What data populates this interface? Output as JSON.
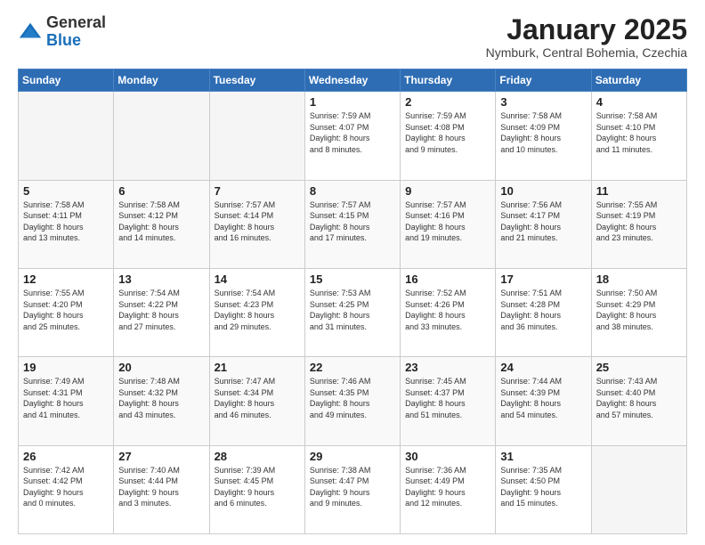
{
  "logo": {
    "general": "General",
    "blue": "Blue"
  },
  "header": {
    "month": "January 2025",
    "location": "Nymburk, Central Bohemia, Czechia"
  },
  "weekdays": [
    "Sunday",
    "Monday",
    "Tuesday",
    "Wednesday",
    "Thursday",
    "Friday",
    "Saturday"
  ],
  "weeks": [
    [
      {
        "day": "",
        "info": ""
      },
      {
        "day": "",
        "info": ""
      },
      {
        "day": "",
        "info": ""
      },
      {
        "day": "1",
        "info": "Sunrise: 7:59 AM\nSunset: 4:07 PM\nDaylight: 8 hours\nand 8 minutes."
      },
      {
        "day": "2",
        "info": "Sunrise: 7:59 AM\nSunset: 4:08 PM\nDaylight: 8 hours\nand 9 minutes."
      },
      {
        "day": "3",
        "info": "Sunrise: 7:58 AM\nSunset: 4:09 PM\nDaylight: 8 hours\nand 10 minutes."
      },
      {
        "day": "4",
        "info": "Sunrise: 7:58 AM\nSunset: 4:10 PM\nDaylight: 8 hours\nand 11 minutes."
      }
    ],
    [
      {
        "day": "5",
        "info": "Sunrise: 7:58 AM\nSunset: 4:11 PM\nDaylight: 8 hours\nand 13 minutes."
      },
      {
        "day": "6",
        "info": "Sunrise: 7:58 AM\nSunset: 4:12 PM\nDaylight: 8 hours\nand 14 minutes."
      },
      {
        "day": "7",
        "info": "Sunrise: 7:57 AM\nSunset: 4:14 PM\nDaylight: 8 hours\nand 16 minutes."
      },
      {
        "day": "8",
        "info": "Sunrise: 7:57 AM\nSunset: 4:15 PM\nDaylight: 8 hours\nand 17 minutes."
      },
      {
        "day": "9",
        "info": "Sunrise: 7:57 AM\nSunset: 4:16 PM\nDaylight: 8 hours\nand 19 minutes."
      },
      {
        "day": "10",
        "info": "Sunrise: 7:56 AM\nSunset: 4:17 PM\nDaylight: 8 hours\nand 21 minutes."
      },
      {
        "day": "11",
        "info": "Sunrise: 7:55 AM\nSunset: 4:19 PM\nDaylight: 8 hours\nand 23 minutes."
      }
    ],
    [
      {
        "day": "12",
        "info": "Sunrise: 7:55 AM\nSunset: 4:20 PM\nDaylight: 8 hours\nand 25 minutes."
      },
      {
        "day": "13",
        "info": "Sunrise: 7:54 AM\nSunset: 4:22 PM\nDaylight: 8 hours\nand 27 minutes."
      },
      {
        "day": "14",
        "info": "Sunrise: 7:54 AM\nSunset: 4:23 PM\nDaylight: 8 hours\nand 29 minutes."
      },
      {
        "day": "15",
        "info": "Sunrise: 7:53 AM\nSunset: 4:25 PM\nDaylight: 8 hours\nand 31 minutes."
      },
      {
        "day": "16",
        "info": "Sunrise: 7:52 AM\nSunset: 4:26 PM\nDaylight: 8 hours\nand 33 minutes."
      },
      {
        "day": "17",
        "info": "Sunrise: 7:51 AM\nSunset: 4:28 PM\nDaylight: 8 hours\nand 36 minutes."
      },
      {
        "day": "18",
        "info": "Sunrise: 7:50 AM\nSunset: 4:29 PM\nDaylight: 8 hours\nand 38 minutes."
      }
    ],
    [
      {
        "day": "19",
        "info": "Sunrise: 7:49 AM\nSunset: 4:31 PM\nDaylight: 8 hours\nand 41 minutes."
      },
      {
        "day": "20",
        "info": "Sunrise: 7:48 AM\nSunset: 4:32 PM\nDaylight: 8 hours\nand 43 minutes."
      },
      {
        "day": "21",
        "info": "Sunrise: 7:47 AM\nSunset: 4:34 PM\nDaylight: 8 hours\nand 46 minutes."
      },
      {
        "day": "22",
        "info": "Sunrise: 7:46 AM\nSunset: 4:35 PM\nDaylight: 8 hours\nand 49 minutes."
      },
      {
        "day": "23",
        "info": "Sunrise: 7:45 AM\nSunset: 4:37 PM\nDaylight: 8 hours\nand 51 minutes."
      },
      {
        "day": "24",
        "info": "Sunrise: 7:44 AM\nSunset: 4:39 PM\nDaylight: 8 hours\nand 54 minutes."
      },
      {
        "day": "25",
        "info": "Sunrise: 7:43 AM\nSunset: 4:40 PM\nDaylight: 8 hours\nand 57 minutes."
      }
    ],
    [
      {
        "day": "26",
        "info": "Sunrise: 7:42 AM\nSunset: 4:42 PM\nDaylight: 9 hours\nand 0 minutes."
      },
      {
        "day": "27",
        "info": "Sunrise: 7:40 AM\nSunset: 4:44 PM\nDaylight: 9 hours\nand 3 minutes."
      },
      {
        "day": "28",
        "info": "Sunrise: 7:39 AM\nSunset: 4:45 PM\nDaylight: 9 hours\nand 6 minutes."
      },
      {
        "day": "29",
        "info": "Sunrise: 7:38 AM\nSunset: 4:47 PM\nDaylight: 9 hours\nand 9 minutes."
      },
      {
        "day": "30",
        "info": "Sunrise: 7:36 AM\nSunset: 4:49 PM\nDaylight: 9 hours\nand 12 minutes."
      },
      {
        "day": "31",
        "info": "Sunrise: 7:35 AM\nSunset: 4:50 PM\nDaylight: 9 hours\nand 15 minutes."
      },
      {
        "day": "",
        "info": ""
      }
    ]
  ]
}
